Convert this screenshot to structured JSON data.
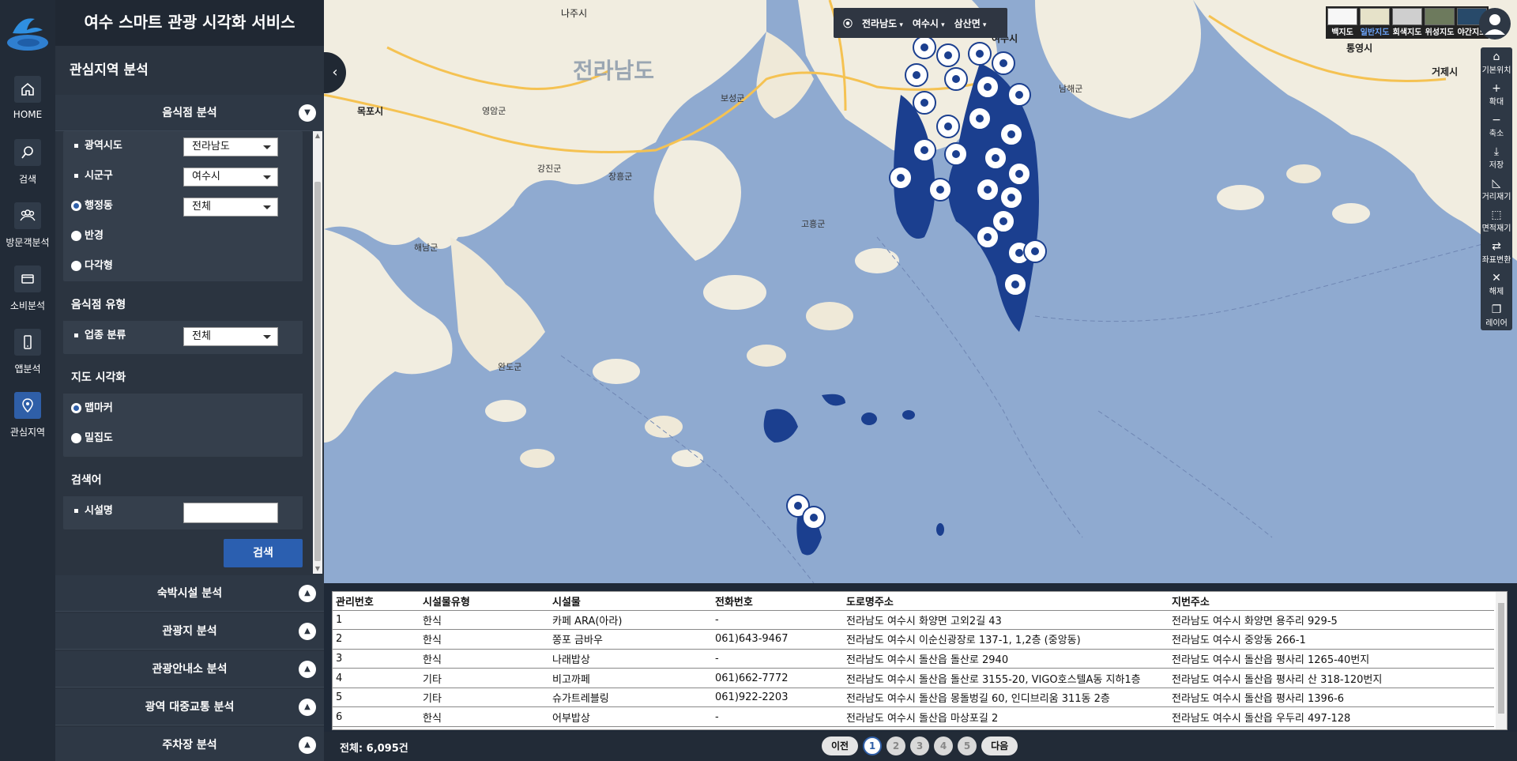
{
  "app": {
    "title": "여수 스마트 관광 시각화 서비스"
  },
  "rail": [
    {
      "label": "HOME",
      "icon": "home-icon"
    },
    {
      "label": "검색",
      "icon": "search-icon"
    },
    {
      "label": "방문객분석",
      "icon": "visitors-icon"
    },
    {
      "label": "소비분석",
      "icon": "card-icon"
    },
    {
      "label": "앱분석",
      "icon": "phone-icon"
    },
    {
      "label": "관심지역",
      "icon": "location-pin-icon"
    }
  ],
  "panel": {
    "section_title": "관심지역 분석",
    "restaurant_analysis": "음식점 분석",
    "area_filters": [
      {
        "label": "광역시도",
        "value": "전라남도",
        "type": "select"
      },
      {
        "label": "시군구",
        "value": "여수시",
        "type": "select"
      },
      {
        "label": "행정동",
        "value": "전체",
        "type": "radio-select",
        "selected": true
      },
      {
        "label": "반경",
        "type": "radio"
      },
      {
        "label": "다각형",
        "type": "radio"
      }
    ],
    "type_card": {
      "title": "음식점 유형",
      "label": "업종 분류",
      "value": "전체"
    },
    "viz_card": {
      "title": "지도 시각화",
      "options": [
        "맵마커",
        "밀집도"
      ]
    },
    "keyword_card": {
      "title": "검색어",
      "label": "시설명",
      "placeholder": ""
    },
    "search_button": "검색",
    "accordions": [
      "숙박시설 분석",
      "관광지 분석",
      "관광안내소 분석",
      "광역 대중교통 분석",
      "주차장 분석"
    ]
  },
  "map": {
    "region_bar": [
      "전라남도",
      "여수시",
      "삼산면"
    ],
    "map_types": [
      "백지도",
      "일반지도",
      "회색지도",
      "위성지도",
      "야간지도"
    ],
    "active_map_type": "일반지도",
    "tools": [
      {
        "label": "기본위치",
        "icon": "home-icon"
      },
      {
        "label": "확대",
        "icon": "plus-icon"
      },
      {
        "label": "축소",
        "icon": "minus-icon"
      },
      {
        "label": "저장",
        "icon": "download-icon"
      },
      {
        "label": "거리재기",
        "icon": "ruler-icon"
      },
      {
        "label": "면적재기",
        "icon": "area-icon"
      },
      {
        "label": "좌표변환",
        "icon": "coordinate-icon"
      },
      {
        "label": "해제",
        "icon": "close-icon"
      },
      {
        "label": "레이어",
        "icon": "layers-icon"
      }
    ],
    "labels": [
      "전라남도",
      "나주시",
      "목포시",
      "영암군",
      "강진군",
      "장흥군",
      "보성군",
      "해남군",
      "완도군",
      "고흥군",
      "남해군",
      "통영시",
      "거제시",
      "여수시"
    ]
  },
  "table": {
    "columns": [
      "관리번호",
      "시설물유형",
      "시설물",
      "전화번호",
      "도로명주소",
      "지번주소"
    ],
    "rows": [
      [
        "1",
        "한식",
        "카페 ARA(아라)",
        "-",
        "전라남도 여수시 화양면 고외2길 43",
        "전라남도 여수시 화양면 용주리 929-5"
      ],
      [
        "2",
        "한식",
        "쫑포 금바우",
        "061)643-9467",
        "전라남도 여수시 이순신광장로 137-1, 1,2층 (중앙동)",
        "전라남도 여수시 중앙동 266-1"
      ],
      [
        "3",
        "한식",
        "나래밥상",
        "-",
        "전라남도 여수시 돌산읍 돌산로 2940",
        "전라남도 여수시 돌산읍 평사리 1265-40번지"
      ],
      [
        "4",
        "기타",
        "비고까페",
        "061)662-7772",
        "전라남도 여수시 돌산읍 돌산로 3155-20, VIGO호스텔A동 지하1층",
        "전라남도 여수시 돌산읍 평사리 산 318-120번지"
      ],
      [
        "5",
        "기타",
        "슈가트레블링",
        "061)922-2203",
        "전라남도 여수시 돌산읍 몽돌벙길 60, 인디브리움 311동 2층",
        "전라남도 여수시 돌산읍 평사리 1396-6"
      ],
      [
        "6",
        "한식",
        "어부밥상",
        "-",
        "전라남도 여수시 돌산읍 마상포길 2",
        "전라남도 여수시 돌산읍 우두리 497-128"
      ]
    ]
  },
  "footer": {
    "total": "전체: 6,095건",
    "prev": "이전",
    "next": "다음",
    "pages": [
      "1",
      "2",
      "3",
      "4",
      "5"
    ],
    "current_page": "1"
  },
  "colors": {
    "accent": "#2f5fa8",
    "rail_bg": "#222b37",
    "panel_bg": "#2b3440",
    "sea": "#8faad0",
    "land": "#f1ede0",
    "marker_cluster": "#1b3f8f"
  }
}
